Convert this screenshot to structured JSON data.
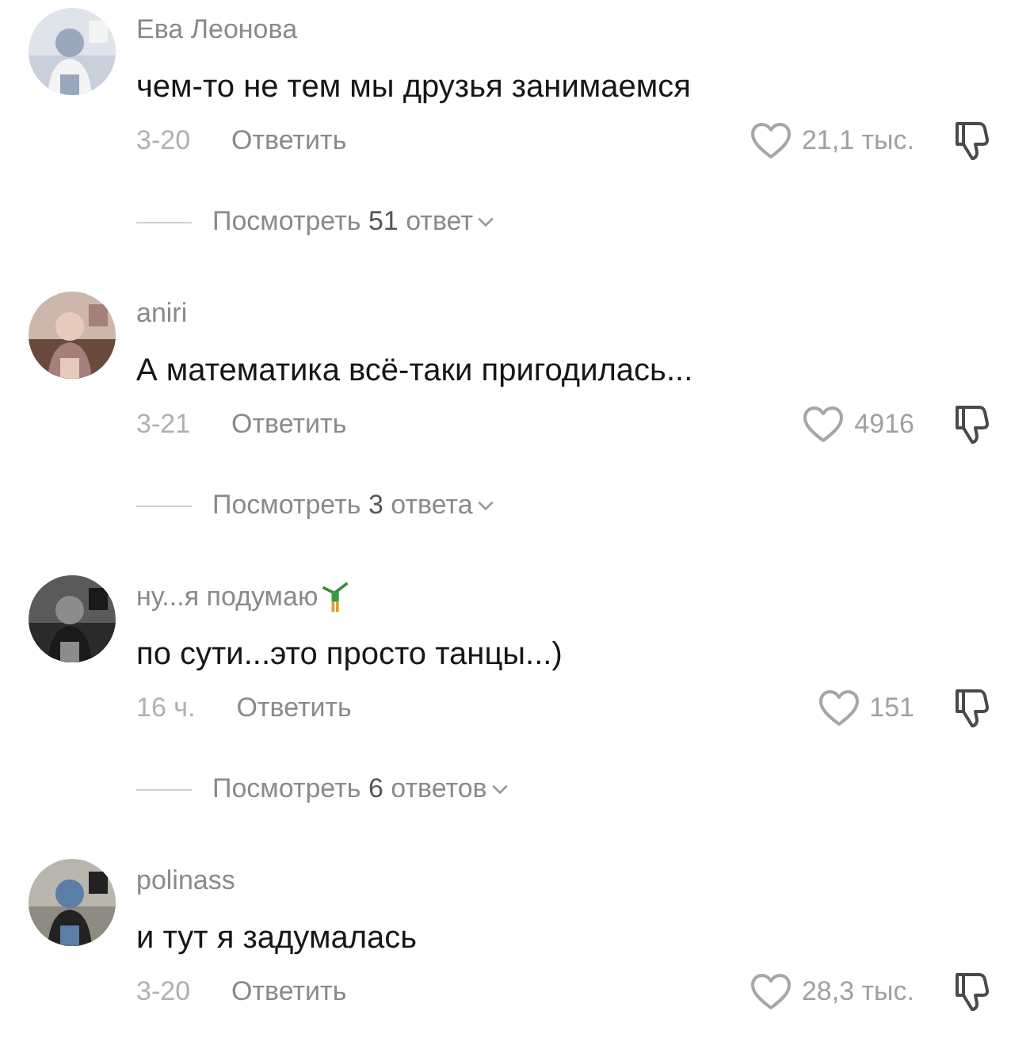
{
  "comments": [
    {
      "author": "Ева Леонова",
      "author_badge": false,
      "text": "чем-то не тем мы друзья занимаемся",
      "date": "3-20",
      "reply_label": "Ответить",
      "likes": "21,1 тыс.",
      "replies": "Посмотреть **51** ответ"
    },
    {
      "author": "aniri",
      "author_badge": false,
      "text": "А математика всё-таки пригодилась...",
      "date": "3-21",
      "reply_label": "Ответить",
      "likes": "4916",
      "replies": "Посмотреть **3** ответа"
    },
    {
      "author": "ну...я подумаю",
      "author_badge": true,
      "text": "по сути...это просто танцы...)",
      "date": "16 ч.",
      "reply_label": "Ответить",
      "likes": "151",
      "replies": "Посмотреть **6** ответов"
    },
    {
      "author": "polinass",
      "author_badge": false,
      "text": "и тут я задумалась",
      "date": "3-20",
      "reply_label": "Ответить",
      "likes": "28,3 тыс."
    }
  ]
}
